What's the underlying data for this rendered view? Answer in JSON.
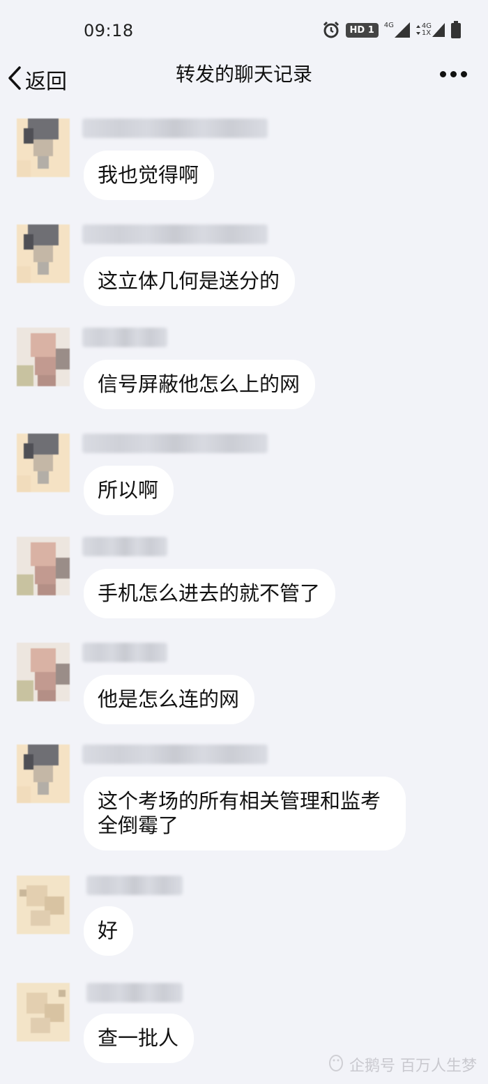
{
  "status_bar": {
    "time": "09:18",
    "hd_badge": "HD 1",
    "net_1": "4G",
    "net_2_top": "4G",
    "net_2_bottom": "1X"
  },
  "nav": {
    "back_label": "返回",
    "title": "转发的聊天记录"
  },
  "messages": [
    {
      "text": "我也觉得啊"
    },
    {
      "text": "这立体几何是送分的"
    },
    {
      "text": "信号屏蔽他怎么上的网"
    },
    {
      "text": "所以啊"
    },
    {
      "text": "手机怎么进去的就不管了"
    },
    {
      "text": "他是怎么连的网"
    },
    {
      "text": "这个考场的所有相关管理和监考全倒霉了"
    },
    {
      "text": "好"
    },
    {
      "text": "查一批人"
    }
  ],
  "watermark": "企鹅号 百万人生梦"
}
